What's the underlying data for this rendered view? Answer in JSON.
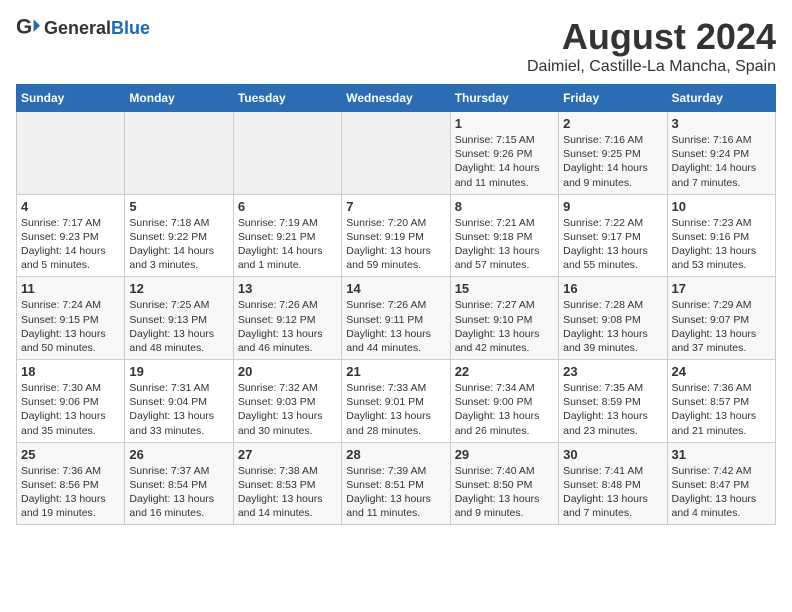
{
  "header": {
    "logo_general": "General",
    "logo_blue": "Blue",
    "month_title": "August 2024",
    "location": "Daimiel, Castille-La Mancha, Spain"
  },
  "weekdays": [
    "Sunday",
    "Monday",
    "Tuesday",
    "Wednesday",
    "Thursday",
    "Friday",
    "Saturday"
  ],
  "weeks": [
    [
      {
        "day": "",
        "info": ""
      },
      {
        "day": "",
        "info": ""
      },
      {
        "day": "",
        "info": ""
      },
      {
        "day": "",
        "info": ""
      },
      {
        "day": "1",
        "info": "Sunrise: 7:15 AM\nSunset: 9:26 PM\nDaylight: 14 hours\nand 11 minutes."
      },
      {
        "day": "2",
        "info": "Sunrise: 7:16 AM\nSunset: 9:25 PM\nDaylight: 14 hours\nand 9 minutes."
      },
      {
        "day": "3",
        "info": "Sunrise: 7:16 AM\nSunset: 9:24 PM\nDaylight: 14 hours\nand 7 minutes."
      }
    ],
    [
      {
        "day": "4",
        "info": "Sunrise: 7:17 AM\nSunset: 9:23 PM\nDaylight: 14 hours\nand 5 minutes."
      },
      {
        "day": "5",
        "info": "Sunrise: 7:18 AM\nSunset: 9:22 PM\nDaylight: 14 hours\nand 3 minutes."
      },
      {
        "day": "6",
        "info": "Sunrise: 7:19 AM\nSunset: 9:21 PM\nDaylight: 14 hours\nand 1 minute."
      },
      {
        "day": "7",
        "info": "Sunrise: 7:20 AM\nSunset: 9:19 PM\nDaylight: 13 hours\nand 59 minutes."
      },
      {
        "day": "8",
        "info": "Sunrise: 7:21 AM\nSunset: 9:18 PM\nDaylight: 13 hours\nand 57 minutes."
      },
      {
        "day": "9",
        "info": "Sunrise: 7:22 AM\nSunset: 9:17 PM\nDaylight: 13 hours\nand 55 minutes."
      },
      {
        "day": "10",
        "info": "Sunrise: 7:23 AM\nSunset: 9:16 PM\nDaylight: 13 hours\nand 53 minutes."
      }
    ],
    [
      {
        "day": "11",
        "info": "Sunrise: 7:24 AM\nSunset: 9:15 PM\nDaylight: 13 hours\nand 50 minutes."
      },
      {
        "day": "12",
        "info": "Sunrise: 7:25 AM\nSunset: 9:13 PM\nDaylight: 13 hours\nand 48 minutes."
      },
      {
        "day": "13",
        "info": "Sunrise: 7:26 AM\nSunset: 9:12 PM\nDaylight: 13 hours\nand 46 minutes."
      },
      {
        "day": "14",
        "info": "Sunrise: 7:26 AM\nSunset: 9:11 PM\nDaylight: 13 hours\nand 44 minutes."
      },
      {
        "day": "15",
        "info": "Sunrise: 7:27 AM\nSunset: 9:10 PM\nDaylight: 13 hours\nand 42 minutes."
      },
      {
        "day": "16",
        "info": "Sunrise: 7:28 AM\nSunset: 9:08 PM\nDaylight: 13 hours\nand 39 minutes."
      },
      {
        "day": "17",
        "info": "Sunrise: 7:29 AM\nSunset: 9:07 PM\nDaylight: 13 hours\nand 37 minutes."
      }
    ],
    [
      {
        "day": "18",
        "info": "Sunrise: 7:30 AM\nSunset: 9:06 PM\nDaylight: 13 hours\nand 35 minutes."
      },
      {
        "day": "19",
        "info": "Sunrise: 7:31 AM\nSunset: 9:04 PM\nDaylight: 13 hours\nand 33 minutes."
      },
      {
        "day": "20",
        "info": "Sunrise: 7:32 AM\nSunset: 9:03 PM\nDaylight: 13 hours\nand 30 minutes."
      },
      {
        "day": "21",
        "info": "Sunrise: 7:33 AM\nSunset: 9:01 PM\nDaylight: 13 hours\nand 28 minutes."
      },
      {
        "day": "22",
        "info": "Sunrise: 7:34 AM\nSunset: 9:00 PM\nDaylight: 13 hours\nand 26 minutes."
      },
      {
        "day": "23",
        "info": "Sunrise: 7:35 AM\nSunset: 8:59 PM\nDaylight: 13 hours\nand 23 minutes."
      },
      {
        "day": "24",
        "info": "Sunrise: 7:36 AM\nSunset: 8:57 PM\nDaylight: 13 hours\nand 21 minutes."
      }
    ],
    [
      {
        "day": "25",
        "info": "Sunrise: 7:36 AM\nSunset: 8:56 PM\nDaylight: 13 hours\nand 19 minutes."
      },
      {
        "day": "26",
        "info": "Sunrise: 7:37 AM\nSunset: 8:54 PM\nDaylight: 13 hours\nand 16 minutes."
      },
      {
        "day": "27",
        "info": "Sunrise: 7:38 AM\nSunset: 8:53 PM\nDaylight: 13 hours\nand 14 minutes."
      },
      {
        "day": "28",
        "info": "Sunrise: 7:39 AM\nSunset: 8:51 PM\nDaylight: 13 hours\nand 11 minutes."
      },
      {
        "day": "29",
        "info": "Sunrise: 7:40 AM\nSunset: 8:50 PM\nDaylight: 13 hours\nand 9 minutes."
      },
      {
        "day": "30",
        "info": "Sunrise: 7:41 AM\nSunset: 8:48 PM\nDaylight: 13 hours\nand 7 minutes."
      },
      {
        "day": "31",
        "info": "Sunrise: 7:42 AM\nSunset: 8:47 PM\nDaylight: 13 hours\nand 4 minutes."
      }
    ]
  ]
}
